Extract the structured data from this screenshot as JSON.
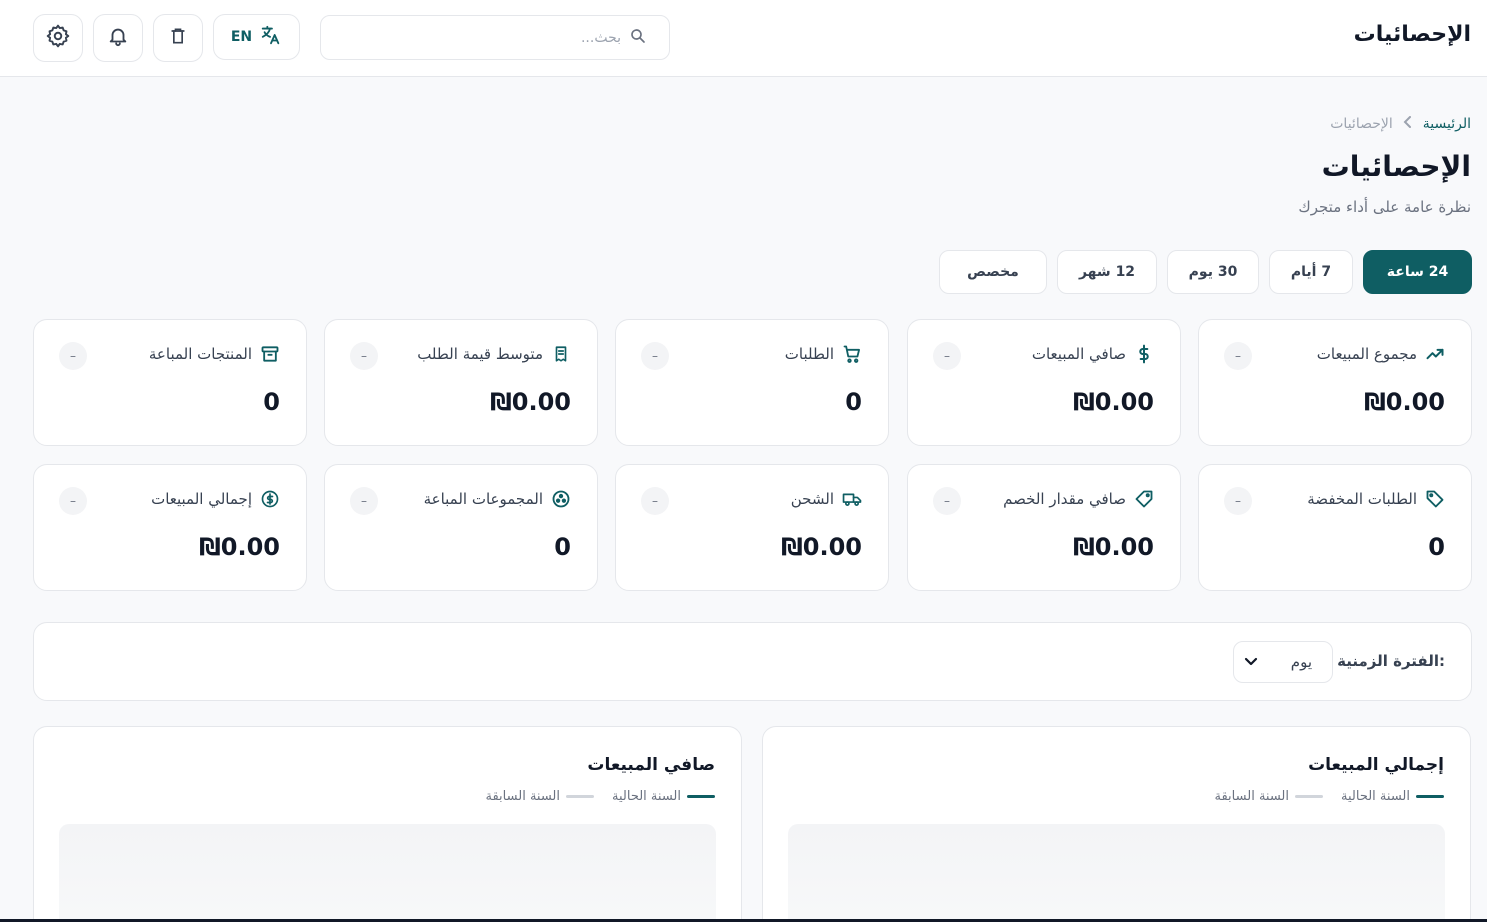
{
  "header": {
    "title": "الإحصائيات",
    "search_placeholder": "بحث...",
    "language_label": "EN"
  },
  "breadcrumb": {
    "home": "الرئيسية",
    "current": "الإحصائيات"
  },
  "page": {
    "title": "الإحصائيات",
    "subtitle": "نظرة عامة على أداء متجرك"
  },
  "range_tabs": [
    {
      "label": "24 ساعة",
      "active": true
    },
    {
      "label": "7 أيام",
      "active": false
    },
    {
      "label": "30 يوم",
      "active": false
    },
    {
      "label": "12 شهر",
      "active": false
    },
    {
      "label": "مخصص",
      "active": false
    }
  ],
  "stats": [
    {
      "label": "مجموع المبيعات",
      "value": "₪0.00",
      "trend": "–",
      "icon": "trending-up-icon"
    },
    {
      "label": "صافي المبيعات",
      "value": "₪0.00",
      "trend": "–",
      "icon": "dollar-icon"
    },
    {
      "label": "الطلبات",
      "value": "0",
      "trend": "–",
      "icon": "cart-icon"
    },
    {
      "label": "متوسط قيمة الطلب",
      "value": "₪0.00",
      "trend": "–",
      "icon": "receipt-icon"
    },
    {
      "label": "المنتجات المباعة",
      "value": "0",
      "trend": "–",
      "icon": "archive-icon"
    },
    {
      "label": "الطلبات المخفضة",
      "value": "0",
      "trend": "–",
      "icon": "tags-icon"
    },
    {
      "label": "صافي مقدار الخصم",
      "value": "₪0.00",
      "trend": "–",
      "icon": "tag-icon"
    },
    {
      "label": "الشحن",
      "value": "₪0.00",
      "trend": "–",
      "icon": "truck-icon"
    },
    {
      "label": "المجموعات المباعة",
      "value": "0",
      "trend": "–",
      "icon": "group-icon"
    },
    {
      "label": "إجمالي المبيعات",
      "value": "₪0.00",
      "trend": "–",
      "icon": "dollar-circle-icon"
    }
  ],
  "period": {
    "label": "الفترة الزمنية:",
    "selected": "يوم"
  },
  "charts": [
    {
      "title": "إجمالي المبيعات",
      "current_label": "السنة الحالية",
      "previous_label": "السنة السابقة"
    },
    {
      "title": "صافي المبيعات",
      "current_label": "السنة الحالية",
      "previous_label": "السنة السابقة"
    }
  ],
  "colors": {
    "accent": "#0f5e63",
    "previous_series": "#d1d5db"
  }
}
